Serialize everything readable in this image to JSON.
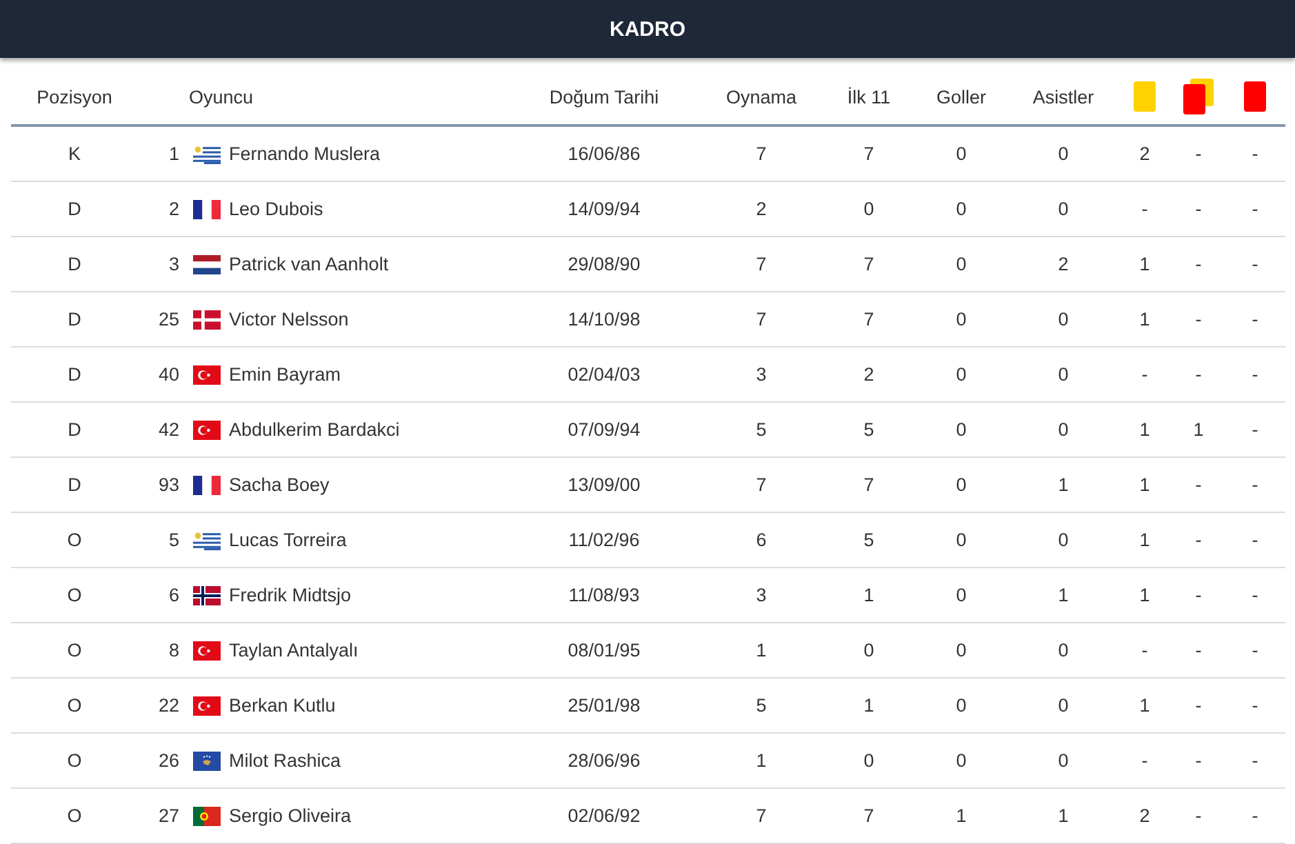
{
  "title": "KADRO",
  "columns": [
    {
      "label": "Pozisyon"
    },
    {
      "label": "Oyuncu"
    },
    {
      "label": "Doğum Tarihi"
    },
    {
      "label": "Oynama"
    },
    {
      "label": "İlk 11"
    },
    {
      "label": "Goller"
    },
    {
      "label": "Asistler"
    }
  ],
  "card_columns": [
    {
      "kind": "yellow"
    },
    {
      "kind": "second_yellow"
    },
    {
      "kind": "red"
    }
  ],
  "rows": [
    {
      "position": "K",
      "number": "1",
      "kind": "uy",
      "name": "Fernando Muslera",
      "birth": "16/06/86",
      "apps": "7",
      "starts": "7",
      "goals": "0",
      "assists": "0",
      "yellow": "2",
      "second_yellow": "-",
      "red": "-"
    },
    {
      "position": "D",
      "number": "2",
      "kind": "fr",
      "name": "Leo Dubois",
      "birth": "14/09/94",
      "apps": "2",
      "starts": "0",
      "goals": "0",
      "assists": "0",
      "yellow": "-",
      "second_yellow": "-",
      "red": "-"
    },
    {
      "position": "D",
      "number": "3",
      "kind": "nl",
      "name": "Patrick van Aanholt",
      "birth": "29/08/90",
      "apps": "7",
      "starts": "7",
      "goals": "0",
      "assists": "2",
      "yellow": "1",
      "second_yellow": "-",
      "red": "-"
    },
    {
      "position": "D",
      "number": "25",
      "kind": "dk",
      "name": "Victor Nelsson",
      "birth": "14/10/98",
      "apps": "7",
      "starts": "7",
      "goals": "0",
      "assists": "0",
      "yellow": "1",
      "second_yellow": "-",
      "red": "-"
    },
    {
      "position": "D",
      "number": "40",
      "kind": "tr",
      "name": "Emin Bayram",
      "birth": "02/04/03",
      "apps": "3",
      "starts": "2",
      "goals": "0",
      "assists": "0",
      "yellow": "-",
      "second_yellow": "-",
      "red": "-"
    },
    {
      "position": "D",
      "number": "42",
      "kind": "tr",
      "name": "Abdulkerim Bardakci",
      "birth": "07/09/94",
      "apps": "5",
      "starts": "5",
      "goals": "0",
      "assists": "0",
      "yellow": "1",
      "second_yellow": "1",
      "red": "-"
    },
    {
      "position": "D",
      "number": "93",
      "kind": "fr",
      "name": "Sacha Boey",
      "birth": "13/09/00",
      "apps": "7",
      "starts": "7",
      "goals": "0",
      "assists": "1",
      "yellow": "1",
      "second_yellow": "-",
      "red": "-"
    },
    {
      "position": "O",
      "number": "5",
      "kind": "uy",
      "name": "Lucas Torreira",
      "birth": "11/02/96",
      "apps": "6",
      "starts": "5",
      "goals": "0",
      "assists": "0",
      "yellow": "1",
      "second_yellow": "-",
      "red": "-"
    },
    {
      "position": "O",
      "number": "6",
      "kind": "no",
      "name": "Fredrik Midtsjo",
      "birth": "11/08/93",
      "apps": "3",
      "starts": "1",
      "goals": "0",
      "assists": "1",
      "yellow": "1",
      "second_yellow": "-",
      "red": "-"
    },
    {
      "position": "O",
      "number": "8",
      "kind": "tr",
      "name": "Taylan Antalyalı",
      "birth": "08/01/95",
      "apps": "1",
      "starts": "0",
      "goals": "0",
      "assists": "0",
      "yellow": "-",
      "second_yellow": "-",
      "red": "-"
    },
    {
      "position": "O",
      "number": "22",
      "kind": "tr",
      "name": "Berkan Kutlu",
      "birth": "25/01/98",
      "apps": "5",
      "starts": "1",
      "goals": "0",
      "assists": "0",
      "yellow": "1",
      "second_yellow": "-",
      "red": "-"
    },
    {
      "position": "O",
      "number": "26",
      "kind": "xk",
      "name": "Milot Rashica",
      "birth": "28/06/96",
      "apps": "1",
      "starts": "0",
      "goals": "0",
      "assists": "0",
      "yellow": "-",
      "second_yellow": "-",
      "red": "-"
    },
    {
      "position": "O",
      "number": "27",
      "kind": "pt",
      "name": "Sergio Oliveira",
      "birth": "02/06/92",
      "apps": "7",
      "starts": "7",
      "goals": "1",
      "assists": "1",
      "yellow": "2",
      "second_yellow": "-",
      "red": "-"
    }
  ]
}
